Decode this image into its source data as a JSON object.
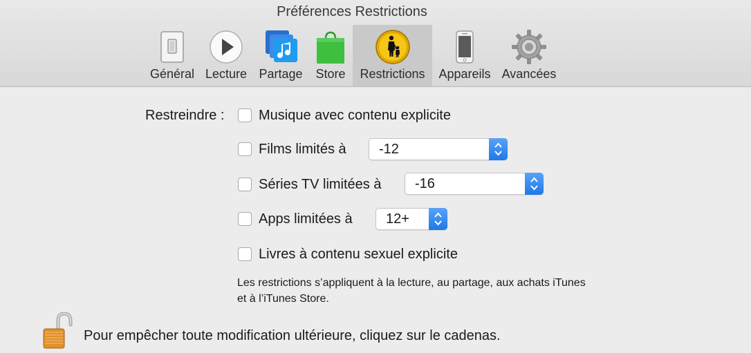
{
  "window": {
    "title": "Préférences Restrictions"
  },
  "toolbar": {
    "tabs": [
      {
        "label": "Général",
        "icon": "switch-icon"
      },
      {
        "label": "Lecture",
        "icon": "play-icon"
      },
      {
        "label": "Partage",
        "icon": "music-share-icon"
      },
      {
        "label": "Store",
        "icon": "shopping-bag-icon"
      },
      {
        "label": "Restrictions",
        "icon": "parental-controls-icon",
        "selected": true
      },
      {
        "label": "Appareils",
        "icon": "iphone-icon"
      },
      {
        "label": "Avancées",
        "icon": "gear-icon"
      }
    ]
  },
  "restrictions": {
    "heading": "Restreindre :",
    "items": [
      {
        "label": "Musique avec contenu explicite",
        "checked": false
      },
      {
        "label": "Films limités à",
        "checked": false,
        "popup_value": "-12"
      },
      {
        "label": "Séries TV limitées à",
        "checked": false,
        "popup_value": "-16"
      },
      {
        "label": "Apps limitées à",
        "checked": false,
        "popup_value": "12+"
      },
      {
        "label": "Livres à contenu sexuel explicite",
        "checked": false
      }
    ],
    "note": "Les restrictions s’appliquent à la lecture, au partage, aux achats iTunes et à l’iTunes Store."
  },
  "lock": {
    "icon": "unlocked-padlock-icon",
    "text": "Pour empêcher toute modification ultérieure, cliquez sur le cadenas."
  },
  "colors": {
    "accent_blue": "#1f78e8",
    "selected_tab_bg": "#c9c9c9",
    "window_bg": "#ececec"
  }
}
